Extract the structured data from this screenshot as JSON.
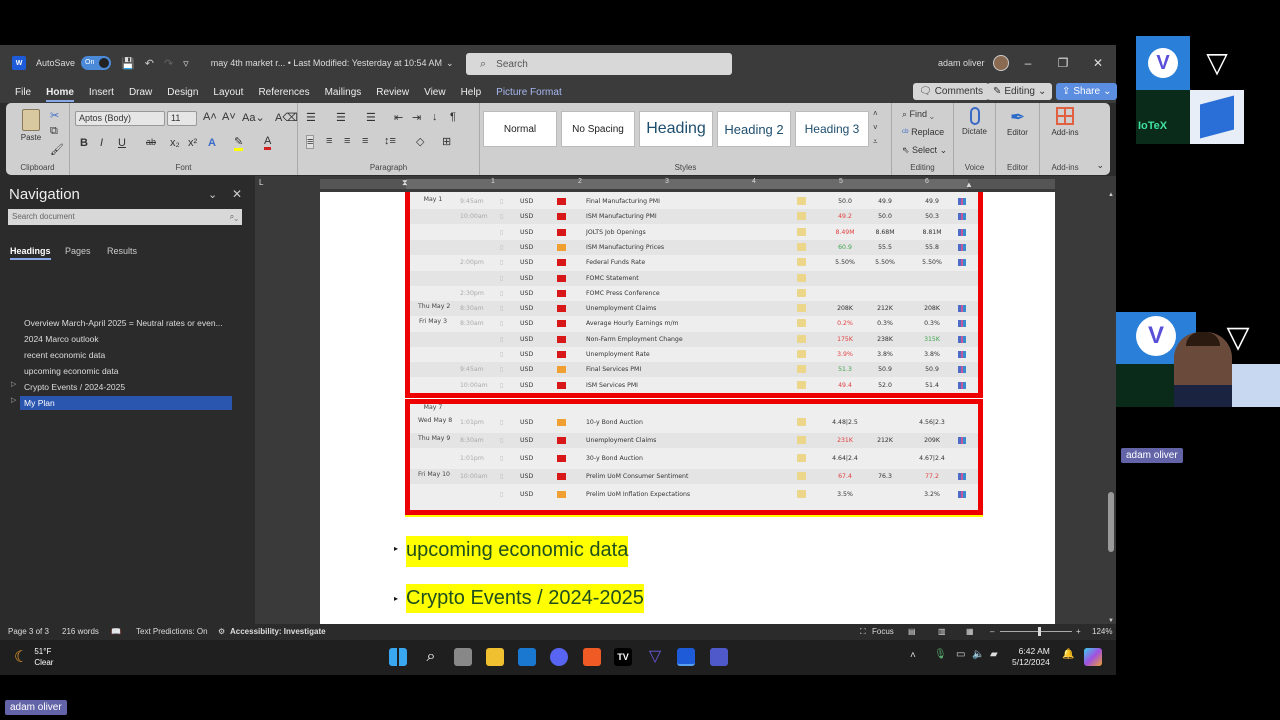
{
  "window": {
    "app_icon": "word-icon",
    "autosave_label": "AutoSave",
    "autosave_state": "On",
    "doc_title": "may 4th market r... • Last Modified: Yesterday at 10:54 AM",
    "search_placeholder": "Search",
    "user_name": "adam oliver"
  },
  "menu": {
    "items": [
      "File",
      "Home",
      "Insert",
      "Draw",
      "Design",
      "Layout",
      "References",
      "Mailings",
      "Review",
      "View",
      "Help",
      "Picture Format"
    ],
    "active": "Home",
    "comments_label": "Comments",
    "editing_label": "Editing",
    "share_label": "Share"
  },
  "ribbon": {
    "clipboard": {
      "paste_label": "Paste",
      "group_label": "Clipboard"
    },
    "font": {
      "font_name": "Aptos (Body)",
      "font_size": "11",
      "group_label": "Font",
      "buttons": [
        "B",
        "I",
        "U",
        "ab",
        "x₂",
        "x²"
      ]
    },
    "paragraph": {
      "group_label": "Paragraph"
    },
    "styles": {
      "items": [
        "Normal",
        "No Spacing",
        "Heading",
        "Heading 2",
        "Heading 3"
      ],
      "group_label": "Styles"
    },
    "editing": {
      "find": "Find",
      "replace": "Replace",
      "select": "Select",
      "group_label": "Editing"
    },
    "voice": {
      "dictate": "Dictate",
      "group_label": "Voice"
    },
    "editor": {
      "label": "Editor",
      "group_label": "Editor"
    },
    "addins": {
      "label": "Add-ins",
      "group_label": "Add-ins"
    }
  },
  "navigation": {
    "title": "Navigation",
    "search_placeholder": "Search document",
    "tabs": [
      "Headings",
      "Pages",
      "Results"
    ],
    "active_tab": "Headings",
    "headings": [
      {
        "label": "Overview March-April 2025 = Neutral rates or even...",
        "expandable": false
      },
      {
        "label": "2024 Marco outlook",
        "expandable": false
      },
      {
        "label": "recent economic data",
        "expandable": false
      },
      {
        "label": "upcoming economic data",
        "expandable": false
      },
      {
        "label": "Crypto Events / 2024-2025",
        "expandable": true
      },
      {
        "label": "My Plan",
        "expandable": true,
        "selected": true
      }
    ]
  },
  "ruler": {
    "numbers": [
      "1",
      "2",
      "3",
      "4",
      "5",
      "6"
    ]
  },
  "calendar_table_1": {
    "rows": [
      {
        "date": "May 1",
        "time": "9:45am",
        "currency": "USD",
        "impact": "high",
        "event": "Final Manufacturing PMI",
        "actual": "50.0",
        "actual_color": "",
        "forecast": "49.9",
        "previous": "49.9",
        "previous_color": "",
        "graph": true
      },
      {
        "date": "",
        "time": "10:00am",
        "currency": "USD",
        "impact": "high",
        "event": "ISM Manufacturing PMI",
        "actual": "49.2",
        "actual_color": "red",
        "forecast": "50.0",
        "previous": "50.3",
        "previous_color": "",
        "graph": true
      },
      {
        "date": "",
        "time": "",
        "currency": "USD",
        "impact": "high",
        "event": "JOLTS Job Openings",
        "actual": "8.49M",
        "actual_color": "red",
        "forecast": "8.68M",
        "previous": "8.81M",
        "previous_color": "",
        "graph": true
      },
      {
        "date": "",
        "time": "",
        "currency": "USD",
        "impact": "medium",
        "event": "ISM Manufacturing Prices",
        "actual": "60.9",
        "actual_color": "green",
        "forecast": "55.5",
        "previous": "55.8",
        "previous_color": "",
        "graph": true
      },
      {
        "date": "",
        "time": "2:00pm",
        "currency": "USD",
        "impact": "high",
        "event": "Federal Funds Rate",
        "actual": "5.50%",
        "actual_color": "",
        "forecast": "5.50%",
        "previous": "5.50%",
        "previous_color": "",
        "graph": true
      },
      {
        "date": "",
        "time": "",
        "currency": "USD",
        "impact": "high",
        "event": "FOMC Statement",
        "actual": "",
        "actual_color": "",
        "forecast": "",
        "previous": "",
        "previous_color": "",
        "graph": false
      },
      {
        "date": "",
        "time": "2:30pm",
        "currency": "USD",
        "impact": "high",
        "event": "FOMC Press Conference",
        "actual": "",
        "actual_color": "",
        "forecast": "",
        "previous": "",
        "previous_color": "",
        "graph": false
      },
      {
        "date": "Thu May 2",
        "time": "8:30am",
        "currency": "USD",
        "impact": "high",
        "event": "Unemployment Claims",
        "actual": "208K",
        "actual_color": "",
        "forecast": "212K",
        "previous": "208K",
        "previous_color": "",
        "graph": true
      },
      {
        "date": "Fri May 3",
        "time": "8:30am",
        "currency": "USD",
        "impact": "high",
        "event": "Average Hourly Earnings m/m",
        "actual": "0.2%",
        "actual_color": "red",
        "forecast": "0.3%",
        "previous": "0.3%",
        "previous_color": "",
        "graph": true
      },
      {
        "date": "",
        "time": "",
        "currency": "USD",
        "impact": "high",
        "event": "Non-Farm Employment Change",
        "actual": "175K",
        "actual_color": "red",
        "forecast": "238K",
        "previous": "315K",
        "previous_color": "green",
        "graph": true
      },
      {
        "date": "",
        "time": "",
        "currency": "USD",
        "impact": "high",
        "event": "Unemployment Rate",
        "actual": "3.9%",
        "actual_color": "red",
        "forecast": "3.8%",
        "previous": "3.8%",
        "previous_color": "",
        "graph": true
      },
      {
        "date": "",
        "time": "9:45am",
        "currency": "USD",
        "impact": "medium",
        "event": "Final Services PMI",
        "actual": "51.3",
        "actual_color": "green",
        "forecast": "50.9",
        "previous": "50.9",
        "previous_color": "",
        "graph": true
      },
      {
        "date": "",
        "time": "10:00am",
        "currency": "USD",
        "impact": "high",
        "event": "ISM Services PMI",
        "actual": "49.4",
        "actual_color": "red",
        "forecast": "52.0",
        "previous": "51.4",
        "previous_color": "",
        "graph": true
      }
    ]
  },
  "calendar_table_2": {
    "header_date": "May 7",
    "rows": [
      {
        "date": "Wed May 8",
        "time": "1:01pm",
        "currency": "USD",
        "impact": "medium",
        "event": "10-y Bond Auction",
        "actual": "4.48|2.5",
        "actual_color": "",
        "forecast": "",
        "previous": "4.56|2.3",
        "previous_color": "",
        "graph": false
      },
      {
        "date": "Thu May 9",
        "time": "8:30am",
        "currency": "USD",
        "impact": "high",
        "event": "Unemployment Claims",
        "actual": "231K",
        "actual_color": "red",
        "forecast": "212K",
        "previous": "209K",
        "previous_color": "",
        "graph": true
      },
      {
        "date": "",
        "time": "1:01pm",
        "currency": "USD",
        "impact": "high",
        "event": "30-y Bond Auction",
        "actual": "4.64|2.4",
        "actual_color": "",
        "forecast": "",
        "previous": "4.67|2.4",
        "previous_color": "",
        "graph": false
      },
      {
        "date": "Fri May 10",
        "time": "10:00am",
        "currency": "USD",
        "impact": "high",
        "event": "Prelim UoM Consumer Sentiment",
        "actual": "67.4",
        "actual_color": "red",
        "forecast": "76.3",
        "previous": "77.2",
        "previous_color": "red",
        "graph": true
      },
      {
        "date": "",
        "time": "",
        "currency": "USD",
        "impact": "medium",
        "event": "Prelim UoM Inflation Expectations",
        "actual": "3.5%",
        "actual_color": "",
        "forecast": "",
        "previous": "3.2%",
        "previous_color": "",
        "graph": true
      }
    ]
  },
  "document": {
    "heading_upcoming": "upcoming economic data",
    "heading_crypto": "Crypto Events / 2024-2025"
  },
  "statusbar": {
    "page": "Page 3 of 3",
    "words": "216 words",
    "text_predictions": "Text Predictions: On",
    "accessibility": "Accessibility: Investigate",
    "focus": "Focus",
    "zoom": "124%",
    "zoom_level_percent": 124
  },
  "taskbar": {
    "weather_temp": "51°F",
    "weather_cond": "Clear",
    "time": "6:42 AM",
    "date": "5/12/2024",
    "apps": [
      "start",
      "search",
      "task-view",
      "file-explorer",
      "outlook",
      "discord",
      "brave",
      "tradingview",
      "vechain",
      "word",
      "teams"
    ]
  },
  "overlay": {
    "participant_name_1": "adam oliver",
    "participant_name_2": "adam oliver",
    "thumbnail_text": "IoTeX"
  },
  "colors": {
    "ribbon_bg": "#cfcfcf",
    "highlight": "#ffff00",
    "heading_text": "#1f4e1f",
    "table_border": "#ee0000",
    "nav_selected": "#2a56b0",
    "share_bg": "#5b8de0"
  }
}
